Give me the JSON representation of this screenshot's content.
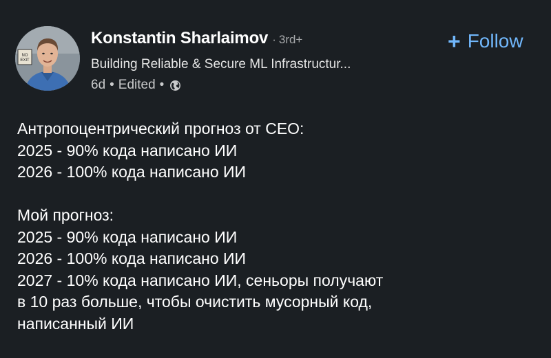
{
  "author": {
    "name": "Konstantin Sharlaimov",
    "separator": "·",
    "degree": "3rd+",
    "headline": "Building Reliable & Secure ML Infrastructur...",
    "time": "6d",
    "edited": "Edited",
    "meta_dot": "•",
    "visibility_icon": "globe-icon",
    "avatar_sign_text": "NO EXIT"
  },
  "follow": {
    "icon": "+",
    "label": "Follow",
    "color": "#71b7fb"
  },
  "post": {
    "paragraph1": [
      "Антропоцентрический прогноз от CEO:",
      "2025 - 90% кода написано ИИ",
      "2026 - 100% кода написано ИИ"
    ],
    "paragraph2": [
      "Мой прогноз:",
      "2025 - 90% кода написано ИИ",
      "2026 - 100% кода написано ИИ",
      "2027 - 10% кода написано ИИ, сеньоры получают",
      "в 10 раз больше, чтобы очистить мусорный код,",
      "написанный ИИ"
    ]
  },
  "colors": {
    "background": "#1b1f23",
    "text": "#ffffff",
    "muted": "#a7a9ab"
  }
}
